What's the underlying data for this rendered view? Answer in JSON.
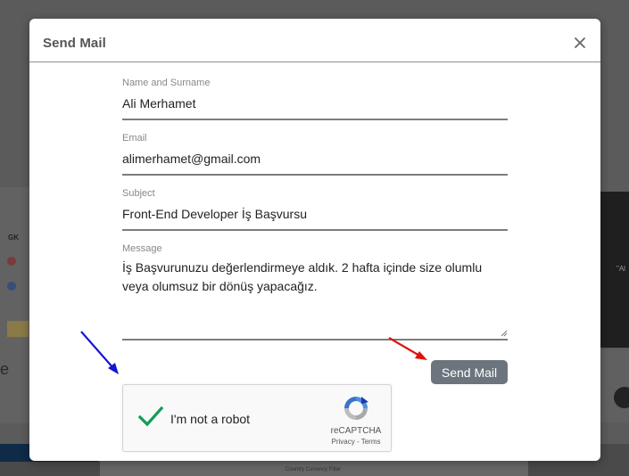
{
  "modal": {
    "title": "Send Mail",
    "fields": {
      "name": {
        "label": "Name and Surname",
        "value": "Ali Merhamet"
      },
      "email": {
        "label": "Email",
        "value": "alimerhamet@gmail.com"
      },
      "subject": {
        "label": "Subject",
        "value": "Front-End Developer İş Başvursu"
      },
      "message": {
        "label": "Message",
        "value": "İş Başvurunuzu değerlendirmeye aldık. 2 hafta içinde size olumlu veya olumsuz bir dönüş yapacağız."
      }
    },
    "send_button": "Send Mail"
  },
  "captcha": {
    "label": "I'm not a robot",
    "brand": "reCAPTCHA",
    "privacy": "Privacy",
    "terms_sep": " - ",
    "terms": "Terms",
    "checked": true
  },
  "annotations": {
    "blue_arrow_color": "#1515d6",
    "red_arrow_color": "#e01010"
  },
  "background": {
    "left_letter": "e",
    "bottom_text": "Country Currency Filter"
  },
  "colors": {
    "send_button_bg": "#6c757d",
    "check_green": "#0f9d58"
  }
}
